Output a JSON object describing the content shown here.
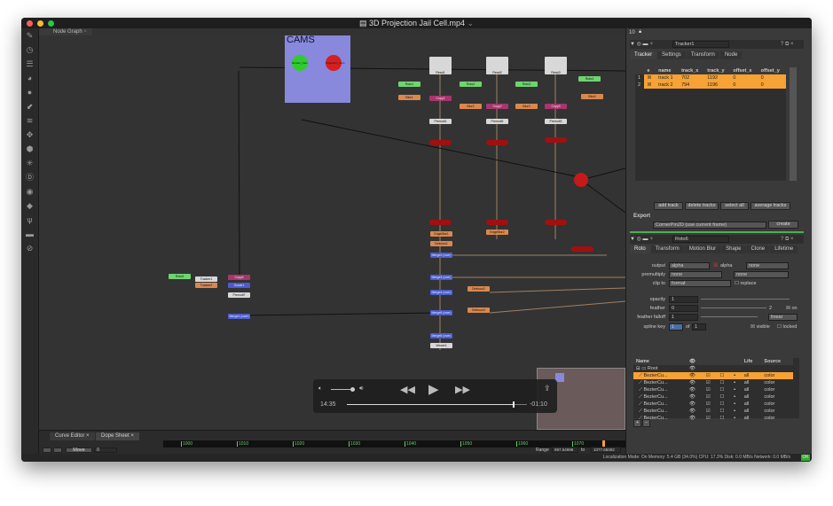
{
  "window": {
    "title": "3D Projection Jail Cell.mp4",
    "title_chevron": "⌄"
  },
  "toolbar_icons": [
    "paint-icon",
    "clock-icon",
    "channels-icon",
    "color-wheel-icon",
    "circle-filter-icon",
    "keyer-icon",
    "layers-icon",
    "transform-icon",
    "3d-cube-icon",
    "particles-icon",
    "deep-icon",
    "eye-icon",
    "tag-icon",
    "tools-icon",
    "other-icon",
    "help-icon"
  ],
  "node_graph": {
    "tab_label": "Node Graph",
    "backdrop_label": "CAMS",
    "nodes": [
      "Render_Cam",
      "Projection_Cam",
      "Read1",
      "Read2",
      "Read3",
      "Roto1",
      "Roto2",
      "Roto3",
      "Roto4",
      "Blur1",
      "Blur2",
      "Blur3",
      "Blur4",
      "Copy1",
      "Copy2",
      "Copy3",
      "Premult1",
      "Premult2",
      "Premult3",
      "Roto5",
      "Tracker1",
      "Tracker2",
      "Copy4",
      "Grade1",
      "Premult7",
      "Merge1 (over)",
      "Merge2 (over)",
      "Merge3 (over)",
      "Merge4 (over)",
      "Merge5 (over)",
      "Merge6 (over)",
      "EdgeBlur1",
      "EdgeBlur2",
      "Defocus1",
      "Defocus2",
      "Defocus3",
      "Viewer1"
    ]
  },
  "player": {
    "elapsed": "14:35",
    "remaining": "-01:10",
    "progress": 0.92,
    "volume": 0.85
  },
  "bottom": {
    "tabs": [
      "Curve Editor",
      "Dope Sheet"
    ],
    "ticks": [
      "1000",
      "1010",
      "1020",
      "1030",
      "1040",
      "1050",
      "1060",
      "1070"
    ],
    "mode": "Move",
    "mode_value": "0",
    "range_label": "Range",
    "range_from": "997.54998",
    "range_to_label": "to",
    "range_to": "1077.65002"
  },
  "status": {
    "text": "Localization Mode: On  Memory: 5.4 GB (34.0%)  CPU: 17.3%  Disk: 0.0 MB/s  Network: 0.0 MB/s",
    "ok": "OK"
  },
  "right": {
    "top_count": "10",
    "tracker": {
      "name": "Tracker1",
      "tabs": [
        "Tracker",
        "Settings",
        "Transform",
        "Node"
      ],
      "columns": [
        "e",
        "name",
        "track_x",
        "track_y",
        "offset_x",
        "offset_y"
      ],
      "rows": [
        {
          "n": "1",
          "name": "track 1",
          "track_x": "702",
          "track_y": "1192",
          "offset_x": "0",
          "offset_y": "0"
        },
        {
          "n": "2",
          "name": "track 2",
          "track_x": "794",
          "track_y": "1196",
          "offset_x": "0",
          "offset_y": "0"
        }
      ],
      "buttons": [
        "add track",
        "delete tracks",
        "select all",
        "average tracks"
      ],
      "export_label": "Export",
      "export_value": "CornerPin2D (use current frame)",
      "create": "create"
    },
    "roto": {
      "name": "Roto6",
      "tabs": [
        "Roto",
        "Transform",
        "Motion Blur",
        "Shape",
        "Clone",
        "Lifetime"
      ],
      "output_label": "output",
      "output": "alpha",
      "output_check": "alpha",
      "output2": "none",
      "premult_label": "premultiply",
      "premult": "none",
      "premult2": "none",
      "clip_label": "clip to",
      "clip": "format",
      "replace": "replace",
      "opacity_label": "opacity",
      "opacity": "1",
      "feather_label": "feather",
      "feather": "0",
      "feather_count": "2",
      "on": "on",
      "falloff_label": "feather falloff",
      "falloff": "1",
      "falloff_type": "linear",
      "spline_label": "spline key",
      "spline_key": "1",
      "of": "of",
      "spline_total": "1",
      "visible": "visible",
      "locked": "locked",
      "tree_columns": [
        "Name",
        "Life",
        "Source"
      ],
      "root": "Root",
      "items": [
        {
          "name": "BezierCu...",
          "life": "all",
          "source": "color"
        },
        {
          "name": "BezierCu...",
          "life": "all",
          "source": "color"
        },
        {
          "name": "BezierCu...",
          "life": "all",
          "source": "color"
        },
        {
          "name": "BezierCu...",
          "life": "all",
          "source": "color"
        },
        {
          "name": "BezierCu...",
          "life": "all",
          "source": "color"
        },
        {
          "name": "BezierCu...",
          "life": "all",
          "source": "color"
        },
        {
          "name": "BezierCu...",
          "life": "all",
          "source": "color"
        }
      ]
    }
  },
  "colors": {
    "accent": "#f7a234",
    "read": "#d8d8d8",
    "roto": "#6fd46f",
    "blur": "#d9884f",
    "copy": "#a8356d",
    "merge": "#4a5ccf",
    "backdrop": "#8888dd",
    "scanline": "#a01010"
  }
}
